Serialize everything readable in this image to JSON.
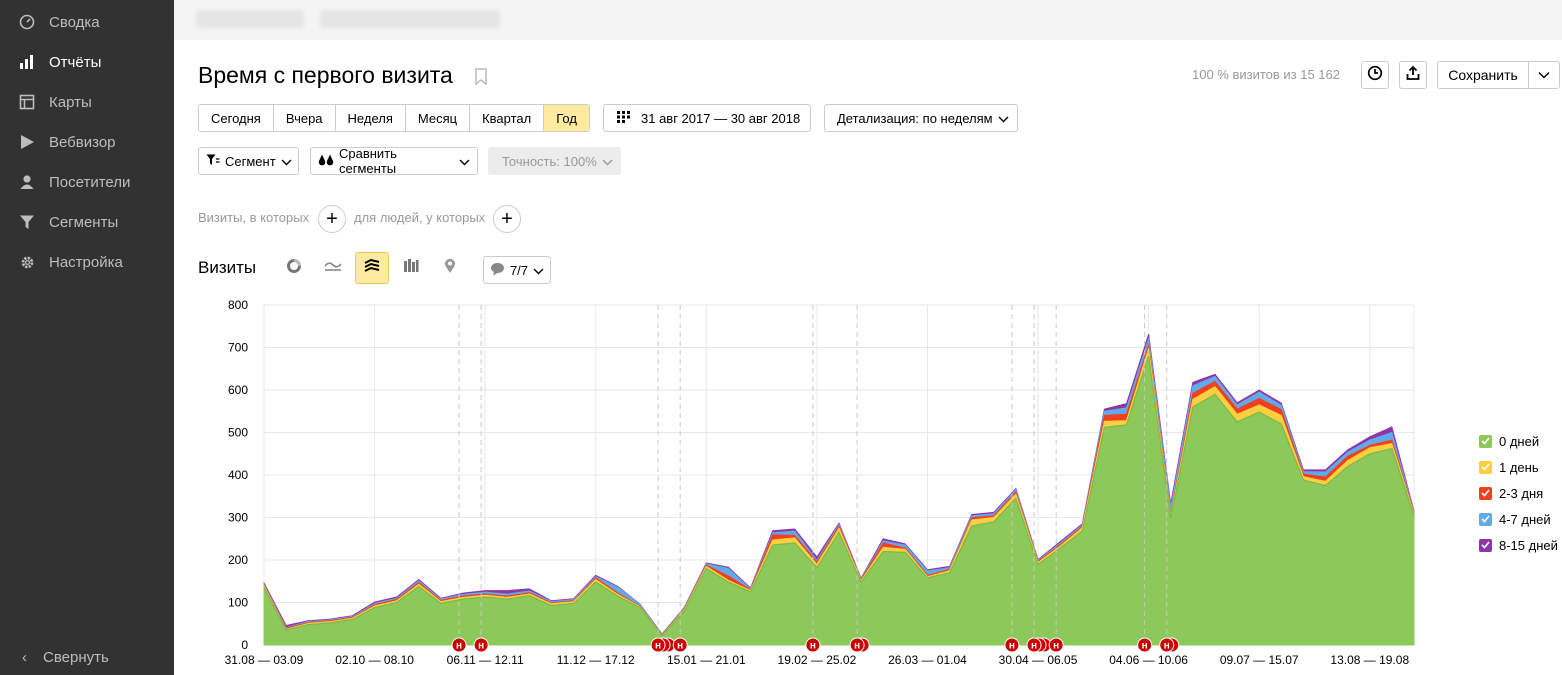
{
  "sidebar": {
    "items": [
      {
        "label": "Сводка",
        "icon": "gauge-icon",
        "active": false
      },
      {
        "label": "Отчёты",
        "icon": "bar-chart-icon",
        "active": true
      },
      {
        "label": "Карты",
        "icon": "map-icon",
        "active": false
      },
      {
        "label": "Вебвизор",
        "icon": "play-icon",
        "active": false
      },
      {
        "label": "Посетители",
        "icon": "user-icon",
        "active": false
      },
      {
        "label": "Сегменты",
        "icon": "funnel-icon",
        "active": false
      },
      {
        "label": "Настройка",
        "icon": "gear-icon",
        "active": false
      }
    ],
    "collapse_label": "Свернуть"
  },
  "header": {
    "title": "Время с первого визита",
    "visits_info": "100 % визитов из 15 162",
    "save_label": "Сохранить"
  },
  "periods": [
    {
      "label": "Сегодня",
      "active": false
    },
    {
      "label": "Вчера",
      "active": false
    },
    {
      "label": "Неделя",
      "active": false
    },
    {
      "label": "Месяц",
      "active": false
    },
    {
      "label": "Квартал",
      "active": false
    },
    {
      "label": "Год",
      "active": true
    }
  ],
  "date_range": "31 авг 2017 — 30 авг 2018",
  "detail": "Детализация: по неделям",
  "segment_label": "Сегмент",
  "compare_label": "Сравнить сегменты",
  "accuracy_label": "Точность: 100%",
  "conditions": {
    "visits_label": "Визиты, в которых",
    "people_label": "для людей, у которых"
  },
  "chart_header": {
    "title": "Визиты",
    "notes_count": "7/7"
  },
  "colors": {
    "s0": "#8dc85a",
    "s1": "#ffcf40",
    "s2": "#ef4020",
    "s3": "#63a9e6",
    "s4": "#8e36a8",
    "accent": "#ffeba0",
    "sidebar": "#323232",
    "marker": "#cc0000"
  },
  "chart_data": {
    "type": "area",
    "stacked": true,
    "ylim": [
      0,
      800
    ],
    "yticks": [
      0,
      100,
      200,
      300,
      400,
      500,
      600,
      700,
      800
    ],
    "tick_labels": [
      "31.08 — 03.09",
      "02.10 — 08.10",
      "06.11 — 12.11",
      "11.12 — 17.12",
      "15.01 — 21.01",
      "19.02 — 25.02",
      "26.03 — 01.04",
      "30.04 — 06.05",
      "04.06 — 10.06",
      "09.07 — 15.07",
      "13.08 — 19.08"
    ],
    "tick_index": [
      0,
      5,
      10,
      15,
      20,
      25,
      30,
      35,
      40,
      45,
      50
    ],
    "grid": true,
    "legend_position": "right",
    "series": [
      {
        "name": "0 дней",
        "values": [
          135,
          35,
          48,
          52,
          60,
          88,
          100,
          138,
          98,
          108,
          113,
          108,
          116,
          93,
          98,
          148,
          115,
          88,
          22,
          80,
          180,
          148,
          125,
          235,
          240,
          182,
          265,
          148,
          220,
          218,
          158,
          170,
          280,
          290,
          345,
          190,
          228,
          268,
          512,
          518,
          680,
          298,
          560,
          590,
          525,
          548,
          520,
          388,
          375,
          420,
          450,
          462,
          305
        ]
      },
      {
        "name": "1 день",
        "values": [
          4,
          2,
          3,
          3,
          3,
          4,
          4,
          5,
          4,
          4,
          4,
          4,
          4,
          4,
          4,
          6,
          4,
          2,
          1,
          3,
          5,
          4,
          3,
          12,
          12,
          8,
          10,
          3,
          10,
          7,
          3,
          5,
          14,
          10,
          10,
          4,
          5,
          8,
          14,
          10,
          18,
          5,
          18,
          18,
          18,
          17,
          20,
          8,
          10,
          14,
          14,
          12,
          4
        ]
      },
      {
        "name": "2-3 дня",
        "values": [
          2,
          2,
          2,
          2,
          2,
          3,
          3,
          4,
          3,
          3,
          3,
          3,
          3,
          2,
          2,
          4,
          3,
          1,
          1,
          2,
          3,
          10,
          2,
          12,
          6,
          5,
          5,
          2,
          10,
          3,
          3,
          3,
          5,
          4,
          5,
          3,
          3,
          3,
          14,
          15,
          8,
          3,
          14,
          12,
          12,
          15,
          14,
          6,
          10,
          10,
          6,
          8,
          2
        ]
      },
      {
        "name": "4-7 дней",
        "values": [
          2,
          2,
          2,
          2,
          2,
          3,
          3,
          4,
          3,
          4,
          4,
          5,
          4,
          3,
          3,
          3,
          14,
          4,
          1,
          2,
          3,
          18,
          2,
          5,
          10,
          4,
          4,
          2,
          5,
          7,
          10,
          4,
          5,
          5,
          5,
          2,
          4,
          3,
          10,
          15,
          15,
          18,
          18,
          12,
          10,
          15,
          10,
          6,
          12,
          10,
          12,
          18,
          2
        ]
      },
      {
        "name": "8-15 дней",
        "values": [
          3,
          5,
          2,
          2,
          2,
          3,
          3,
          3,
          2,
          3,
          4,
          8,
          5,
          2,
          2,
          3,
          2,
          1,
          1,
          1,
          2,
          3,
          2,
          5,
          5,
          8,
          3,
          2,
          5,
          3,
          3,
          3,
          3,
          3,
          3,
          2,
          3,
          3,
          5,
          10,
          10,
          8,
          8,
          5,
          5,
          5,
          5,
          4,
          5,
          5,
          8,
          13,
          2
        ]
      }
    ],
    "markers": [
      {
        "index": 9,
        "count": 1
      },
      {
        "index": 10,
        "count": 1
      },
      {
        "index": 18,
        "count": 3
      },
      {
        "index": 19,
        "count": 1
      },
      {
        "index": 25,
        "count": 1
      },
      {
        "index": 27,
        "count": 2
      },
      {
        "index": 34,
        "count": 1
      },
      {
        "index": 35,
        "count": 3
      },
      {
        "index": 36,
        "count": 1
      },
      {
        "index": 40,
        "count": 1
      },
      {
        "index": 41,
        "count": 2
      }
    ],
    "marker_label": "н"
  }
}
